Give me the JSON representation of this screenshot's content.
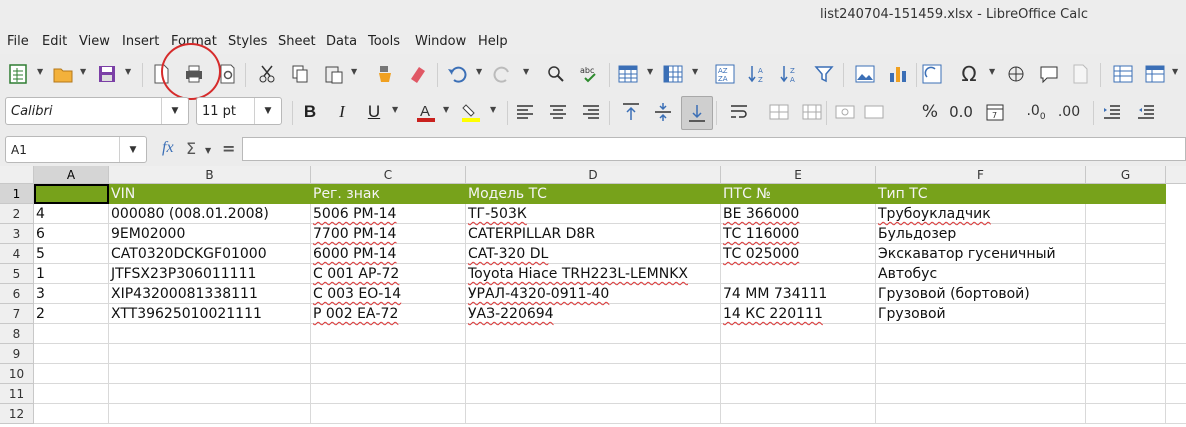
{
  "window": {
    "title": "list240704-151459.xlsx - LibreOffice Calc"
  },
  "menu": [
    "File",
    "Edit",
    "View",
    "Insert",
    "Format",
    "Styles",
    "Sheet",
    "Data",
    "Tools",
    "Window",
    "Help"
  ],
  "font": {
    "name": "Calibri",
    "size": "11 pt"
  },
  "formula": {
    "cell_ref": "A1",
    "fx": "fx",
    "sigma": "Σ",
    "equals": "=",
    "content": ""
  },
  "columns": [
    "A",
    "B",
    "C",
    "D",
    "E",
    "F",
    "G"
  ],
  "rows": [
    "1",
    "2",
    "3",
    "4",
    "5",
    "6",
    "7",
    "8",
    "9",
    "10",
    "11",
    "12"
  ],
  "sheet": {
    "header": [
      "",
      "VIN",
      "Рег. знак",
      "Модель ТС",
      "ПТС №",
      "Тип ТС",
      ""
    ],
    "data": [
      [
        "4",
        "000080 (008.01.2008)",
        "5006 РМ-14",
        "ТГ-503К",
        "ВЕ 366000",
        "Трубоукладчик",
        ""
      ],
      [
        "6",
        "9ЕМ02000",
        "7700 РМ-14",
        "CATERPILLAR D8R",
        "ТС 116000",
        "Бульдозер",
        ""
      ],
      [
        "5",
        "CAT0320DCKGF01000",
        "6000 РМ-14",
        "CAT-320 DL",
        "ТС 025000",
        "Экскаватор гусеничный",
        ""
      ],
      [
        "1",
        "JTFSX23P306011111",
        "С 001 АР-72",
        "Toyota Hiace TRH223L-LEMNKX",
        "",
        "Автобус",
        ""
      ],
      [
        "3",
        "XIP43200081338111",
        "С 003 ЕО-14",
        "УРАЛ-4320-0911-40",
        "74 ММ 734111",
        "Грузовой (бортовой)",
        ""
      ],
      [
        "2",
        "XTT39625010021111",
        "Р 002 ЕА-72",
        "УАЗ-220694",
        "14 КС 220111",
        "Грузовой",
        ""
      ]
    ]
  },
  "colors": {
    "header_fill": "#77a21b",
    "annotation": "#d62b2b"
  }
}
